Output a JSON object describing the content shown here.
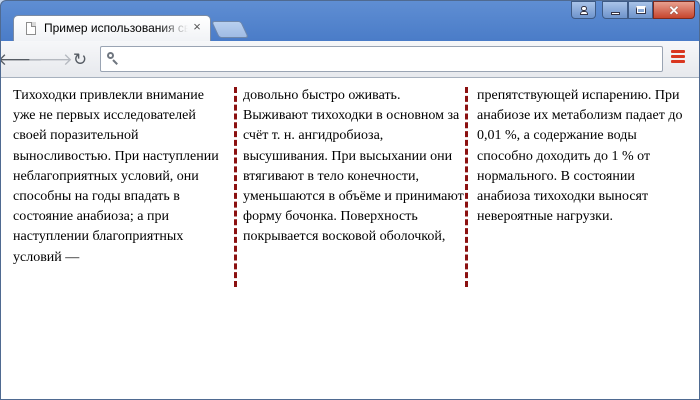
{
  "tab": {
    "title": "Пример использования своиств",
    "close_symbol": "×"
  },
  "window_buttons": {
    "user_icon": "user-icon",
    "minimize_icon": "minimize-icon",
    "maximize_icon": "maximize-icon",
    "close_symbol": "✕"
  },
  "toolbar": {
    "back_symbol": "🡐",
    "forward_symbol": "🡒",
    "reload_symbol": "↻",
    "omnibox_value": "",
    "menu_icon": "hamburger-menu-icon"
  },
  "colors": {
    "accent_menu": "#d9361f",
    "column_rule": "#8b1010"
  },
  "article": {
    "col1": "Тихоходки привлекли внимание уже не первых исследователей своей поразительной выносливостью. При наступлении неблагоприятных условий, они способны на годы впадать в состояние анабиоза; а при наступлении благоприятных условий —",
    "col2": "довольно быстро оживать. Выживают тихоходки в основном за счёт т. н. ангидробиоза, высушивания. При высыхании они втягивают в тело конечности, уменьшаются в объёме и принимают форму бочонка. Поверхность покрывается восковой оболочкой,",
    "col3": "препятствующей испарению. При анабиозе их метаболизм падает до 0,01 %, а содержание воды способно доходить до 1 % от нормального. В состоянии анабиоза тихоходки выносят невероятные нагрузки."
  }
}
